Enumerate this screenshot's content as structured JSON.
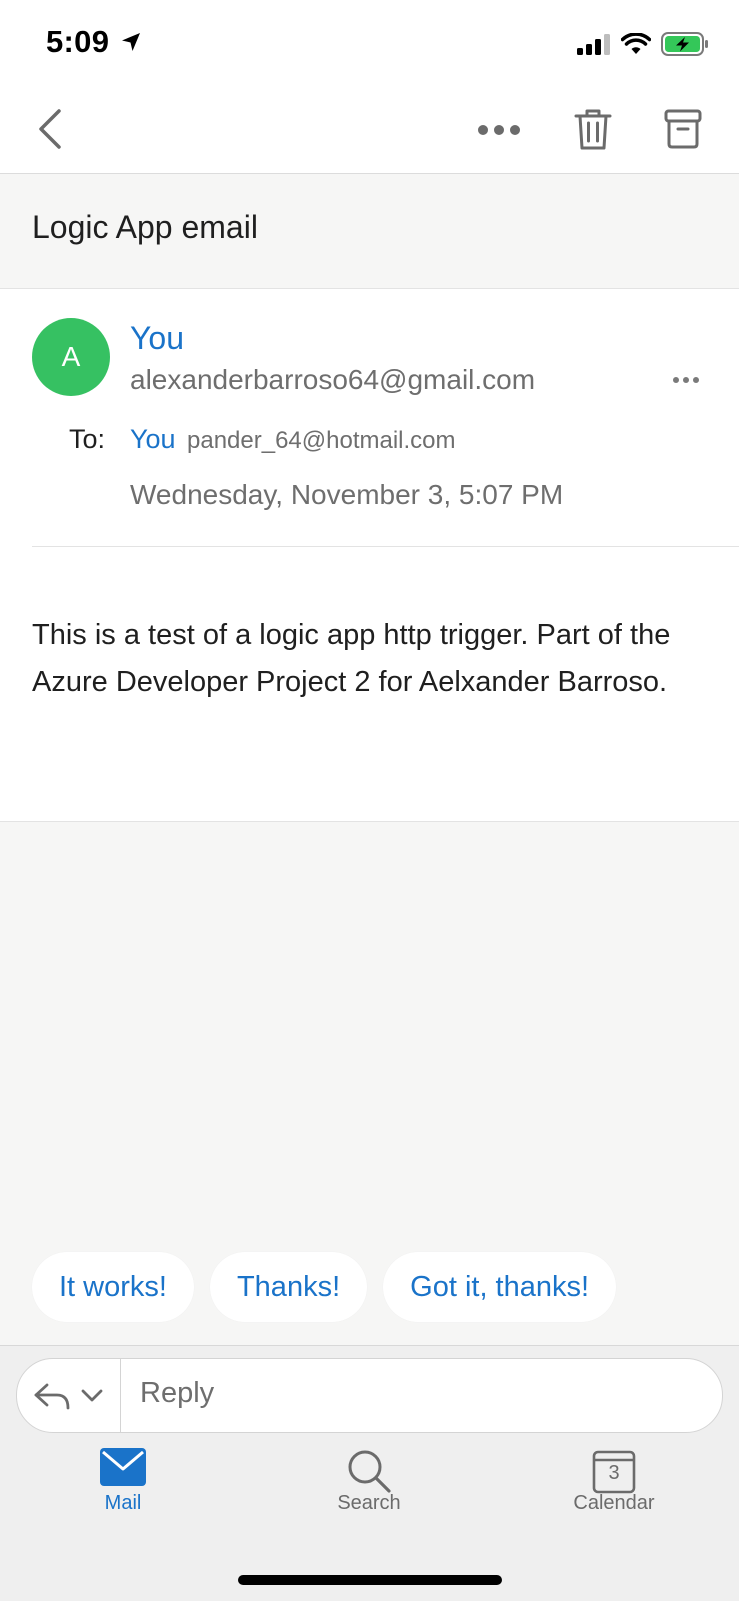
{
  "status_bar": {
    "time": "5:09"
  },
  "toolbar": {
    "back_icon": "chevron-left-icon",
    "more_icon": "ellipsis-icon",
    "delete_icon": "trash-icon",
    "archive_icon": "archive-icon"
  },
  "email": {
    "subject": "Logic App email",
    "avatar_initial": "A",
    "sender_name": "You",
    "sender_email": "alexanderbarroso64@gmail.com",
    "to_label": "To:",
    "to_name": "You",
    "to_email": "pander_64@hotmail.com",
    "date": "Wednesday, November 3, 5:07 PM",
    "body": "This is a test of a logic app http trigger. Part of the Azure Developer Project 2 for Aelxander Barroso."
  },
  "quick_replies": [
    "It works!",
    "Thanks!",
    "Got it, thanks!"
  ],
  "reply": {
    "placeholder": "Reply"
  },
  "tabs": [
    {
      "label": "Mail",
      "icon": "mail-icon",
      "active": true
    },
    {
      "label": "Search",
      "icon": "search-icon",
      "active": false
    },
    {
      "label": "Calendar",
      "icon": "calendar-icon",
      "active": false,
      "badge": "3"
    }
  ],
  "colors": {
    "accent": "#1a73c9",
    "avatar": "#36c162",
    "battery": "#34c759"
  }
}
